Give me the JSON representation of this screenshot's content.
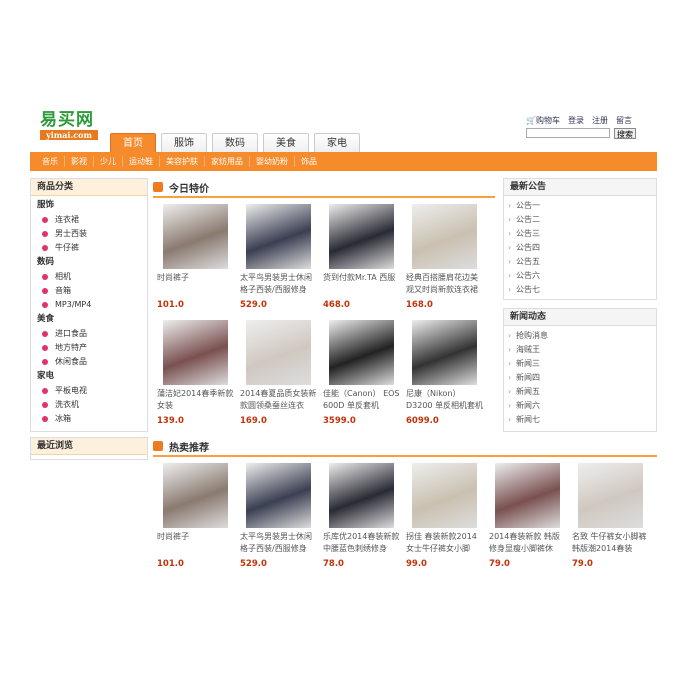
{
  "logo": {
    "cn": "易买网",
    "en": "yimai.com"
  },
  "tabs": [
    "首页",
    "服饰",
    "数码",
    "美食",
    "家电"
  ],
  "toplinks": {
    "cart": "购物车",
    "login": "登录",
    "register": "注册",
    "message": "留言"
  },
  "search": {
    "button": "搜索",
    "value": ""
  },
  "subnav": [
    "音乐",
    "影视",
    "少儿",
    "运动鞋",
    "美容护肤",
    "家纺用品",
    "婴幼奶粉",
    "饰品"
  ],
  "categories": {
    "title": "商品分类",
    "groups": [
      {
        "name": "服饰",
        "items": [
          "连衣裙",
          "男士西装",
          "牛仔裤"
        ]
      },
      {
        "name": "数码",
        "items": [
          "相机",
          "音箱",
          "MP3/MP4"
        ]
      },
      {
        "name": "美食",
        "items": [
          "进口食品",
          "地方特产",
          "休闲食品"
        ]
      },
      {
        "name": "家电",
        "items": [
          "平板电视",
          "洗衣机",
          "冰箱"
        ]
      }
    ]
  },
  "recent": {
    "title": "最近浏览"
  },
  "today": {
    "title": "今日特价",
    "products": [
      {
        "name": "时尚裤子",
        "price": "101.0"
      },
      {
        "name": "太平鸟男装男士休闲格子西装/西服修身",
        "price": "529.0"
      },
      {
        "name": "货到付款Mr.TA 西服",
        "price": "468.0"
      },
      {
        "name": "经典百搭腰肩花边美观又时尚新款连衣裙",
        "price": "168.0"
      },
      {
        "name": "蒲洁妃2014春季新款女装",
        "price": "139.0"
      },
      {
        "name": "2014春夏品质女装新款圆领桑蚕丝连衣",
        "price": "169.0"
      },
      {
        "name": "佳能（Canon） EOS 600D 单反套机",
        "price": "3599.0"
      },
      {
        "name": "尼康（Nikon） D3200 单反相机套机",
        "price": "6099.0"
      }
    ]
  },
  "hot": {
    "title": "热卖推荐",
    "products": [
      {
        "name": "时尚裤子",
        "price": "101.0"
      },
      {
        "name": "太平鸟男装男士休闲格子西装/西服修身",
        "price": "529.0"
      },
      {
        "name": "乐库优2014春装新款中腰蓝色刺绣修身",
        "price": "78.0"
      },
      {
        "name": "拐佳 春装新款2014女士牛仔裤女小脚",
        "price": "99.0"
      },
      {
        "name": "2014春装新款 韩版修身显瘦小脚裤休",
        "price": "79.0"
      },
      {
        "name": "名致 牛仔裤女小脚裤韩版潮2014春装",
        "price": "79.0"
      }
    ]
  },
  "notices": {
    "title": "最新公告",
    "items": [
      "公告一",
      "公告二",
      "公告三",
      "公告四",
      "公告五",
      "公告六",
      "公告七"
    ]
  },
  "news": {
    "title": "新闻动态",
    "items": [
      "抢购消息",
      "海贼王",
      "新闻三",
      "新闻四",
      "新闻五",
      "新闻六",
      "新闻七"
    ]
  }
}
